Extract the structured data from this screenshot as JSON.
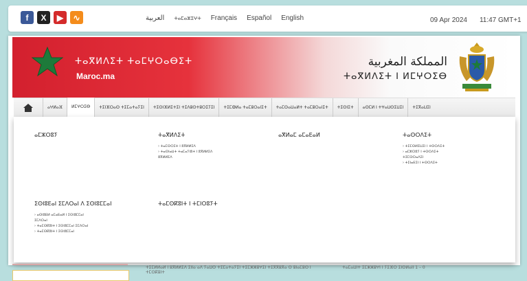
{
  "social": {
    "facebook": "f",
    "x": "X",
    "youtube": "▶",
    "rss": "∿"
  },
  "languages": [
    "العربية",
    "ⵜⴰⵎⴰⵣⵉⵖⵜ",
    "Français",
    "Español",
    "English"
  ],
  "datetime": {
    "date": "09 Apr 2024",
    "time": "11:47 GMT+1"
  },
  "banner": {
    "tifinagh_left": "ⵜⴰⴳⵍⴷⵉⵜ ⵜⴰⵎⵖⵔⴰⴱⵉⵜ",
    "site": "Maroc.ma",
    "arabic": "المملكة المغربية",
    "tifinagh_right": "ⵜⴰⴳⵍⴷⵉⵜ ⵏ ⵍⵎⵖⵔⵉⴱ"
  },
  "nav": {
    "items": [
      "ⴰⵖⵍⴰⴼ",
      "ⵍⵎⵖⵔⵉⴱ",
      "ⵜⵉⵏⴼⵔⴰⵙ ⵜⵉⵎⴰⵜⴰⵢⵉⵏ",
      "ⵜⵉⵙⵏⴼⵍⵉⵜⵉⵏ ⵜⵉⴷⵓⵙⵜⵓⵔⵉⵢⵉⵏ",
      "ⵜⵉⵎⵀⵍⴰ ⵜⴰⵎⵓⵔⴰⵏⵉⵜ",
      "ⵜⴰⵎⵙⴰⵡⴰⵍⵜ ⵜⴰⵎⵓⵔⴰⵏⵉⵜ",
      "ⵜⵉⵙⵏⵉⵜ",
      "ⴰⵙⵎⵍ ⵏ ⵜⵖⴰⵡⵙⵉⵡⵉⵏ",
      "ⵜⵉⴳⴰⵡⵉⵏ"
    ],
    "active_index": 1
  },
  "dropdown": {
    "columns": [
      {
        "heading": "ⴰⵎⵣⵔⵓⵢ",
        "links": []
      },
      {
        "heading": "ⵜⴰⴳⵍⴷⵉⵜ",
        "links": [
          "› ⵜⴰⵎⵙⵔⵉⵜ ⵏ ⵓⴳⵍⵍⵉⴷ",
          "› ⵜⴰⵙⵏⴰⵡⵜ ⵜⴰⵎⴰⵢⵏⵓⵜ ⵏ ⵓⴳⵍⵍⵉⴷ",
          "ⵓⴳⵍⵍⵉⴷ"
        ]
      },
      {
        "heading": "ⴰⴳⵍⴰⵎ ⴰⵎⴰⴹⴰⵍ",
        "links": []
      },
      {
        "heading": "ⵜⴰⵙⵔⴷⵉⵜ",
        "links": [
          "› ⵜⵉⵎⵙⵍⵉⵡⵉⵏ ⵏ ⵜⵙⵔⴷⵉⵜ",
          "› ⴰⵎⵣⵔⵓⵢ ⵏ ⵜⵙⵔⴷⵉⵜ",
          "ⵜⵉⵎⵙⵔⴰⴷⵉⵏ",
          "› ⵜⵉⵏⴰⴹⵉⵏ ⵏ ⵜⵙⵔⴷⵉⵜ"
        ]
      },
      {
        "heading": "ⵉⵙⵏⵓⴹⴰⵏ ⵉⵎⴷⵔⴰⵏ ⴷ ⵉⵙⵏⵓⵎⵎⴰⵏ",
        "links": [
          "› ⴰⵙⵏⵓⴹⵍ ⴰⵎⴰⴹⴰⵍ ⵏ ⵉⵙⵏⵓⵎⵎⴰⵏ",
          "ⵉⵎⴷⵔⴰⵏ",
          "› ⵜⴰⵎⵙⴽⵓⵏⵜ ⵏ ⵉⵙⵏⵓⵎⵎⴰⵏ ⵉⵎⴷⵔⴰⵏ",
          "› ⵜⴰⵎⵙⴽⵓⵏⵜ ⵏ ⵉⵙⵏⵓⵎⵎⴰⵏ"
        ]
      },
      {
        "heading": "ⵜⴰⵎⵙⴽⵓⵏⵜ ⵏ ⵜⵎⵏⵔⵓⵢⵜ",
        "links": []
      }
    ]
  },
  "below": {
    "center": "ⵜⵉⵎⵍⵍⴰⵍ ⵏ ⵓⴳⵍⵍⵉⴷ ⵉⵏⵏⴰ ⴰⴷ ⵢⴰⵡⵙ ⵜⵉⵎⴰⵜⴰⵢⵉⵏ ⵜⵉⵎⵣⵣⵓⵖⵉⵏ ⵜⵉⴳⴳⵓⴳⴰ ⵙ ⵓⵏⴰⵎⵓⵙ ⵏ ⵜⵎⵙⴽⵓⵏⵜ",
    "right": "ⵜⴰⵎⴰⵡⵏⵜ ⵉⵎⵣⵣⵓⵖⵏ ⵏ ⵢⵉⴼⵔ ⵉⵏⵙⵍⴰⵏⵏ 1 – 0"
  }
}
